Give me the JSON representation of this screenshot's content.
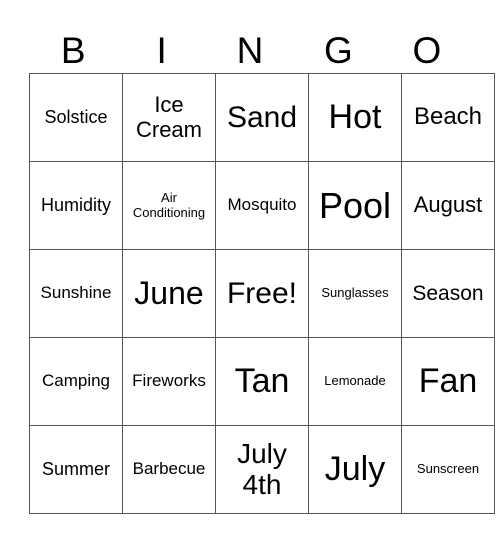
{
  "header": [
    "B",
    "I",
    "N",
    "G",
    "O"
  ],
  "rows": [
    [
      "Solstice",
      "Ice Cream",
      "Sand",
      "Hot",
      "Beach"
    ],
    [
      "Humidity",
      "Air Conditioning",
      "Mosquito",
      "Pool",
      "August"
    ],
    [
      "Sunshine",
      "June",
      "Free!",
      "Sunglasses",
      "Season"
    ],
    [
      "Camping",
      "Fireworks",
      "Tan",
      "Lemonade",
      "Fan"
    ],
    [
      "Summer",
      "Barbecue",
      "July 4th",
      "July",
      "Sunscreen"
    ]
  ]
}
